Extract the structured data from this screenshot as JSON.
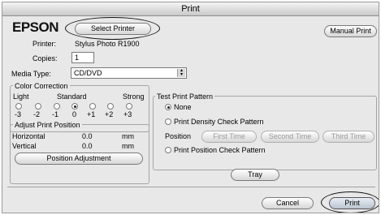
{
  "window": {
    "title": "Print"
  },
  "brand": {
    "logo_text": "EPSON"
  },
  "buttons": {
    "select_printer": "Select Printer",
    "manual_print": "Manual Print",
    "position_adjustment": "Position Adjustment",
    "first_time": "First Time",
    "second_time": "Second Time",
    "third_time": "Third Time",
    "tray": "Tray",
    "cancel": "Cancel",
    "print": "Print"
  },
  "printer": {
    "label": "Printer:",
    "value": "Stylus Photo R1900"
  },
  "copies": {
    "label": "Copies:",
    "value": "1"
  },
  "media_type": {
    "label": "Media Type:",
    "value": "CD/DVD"
  },
  "color_correction": {
    "title": "Color Correction",
    "scale_labels": [
      "Light",
      "Standard",
      "Strong"
    ],
    "options": [
      "-3",
      "-2",
      "-1",
      "0",
      "+1",
      "+2",
      "+3"
    ],
    "selected_index": 3
  },
  "adjust_print_position": {
    "title": "Adjust Print Position",
    "rows": [
      {
        "label": "Horizontal",
        "value": "0.0",
        "unit": "mm"
      },
      {
        "label": "Vertical",
        "value": "0.0",
        "unit": "mm"
      }
    ]
  },
  "test_print_pattern": {
    "title": "Test Print Pattern",
    "options": [
      "None",
      "Print Density Check Pattern",
      "Print Position Check Pattern"
    ],
    "selected": "None",
    "position_label": "Position"
  }
}
